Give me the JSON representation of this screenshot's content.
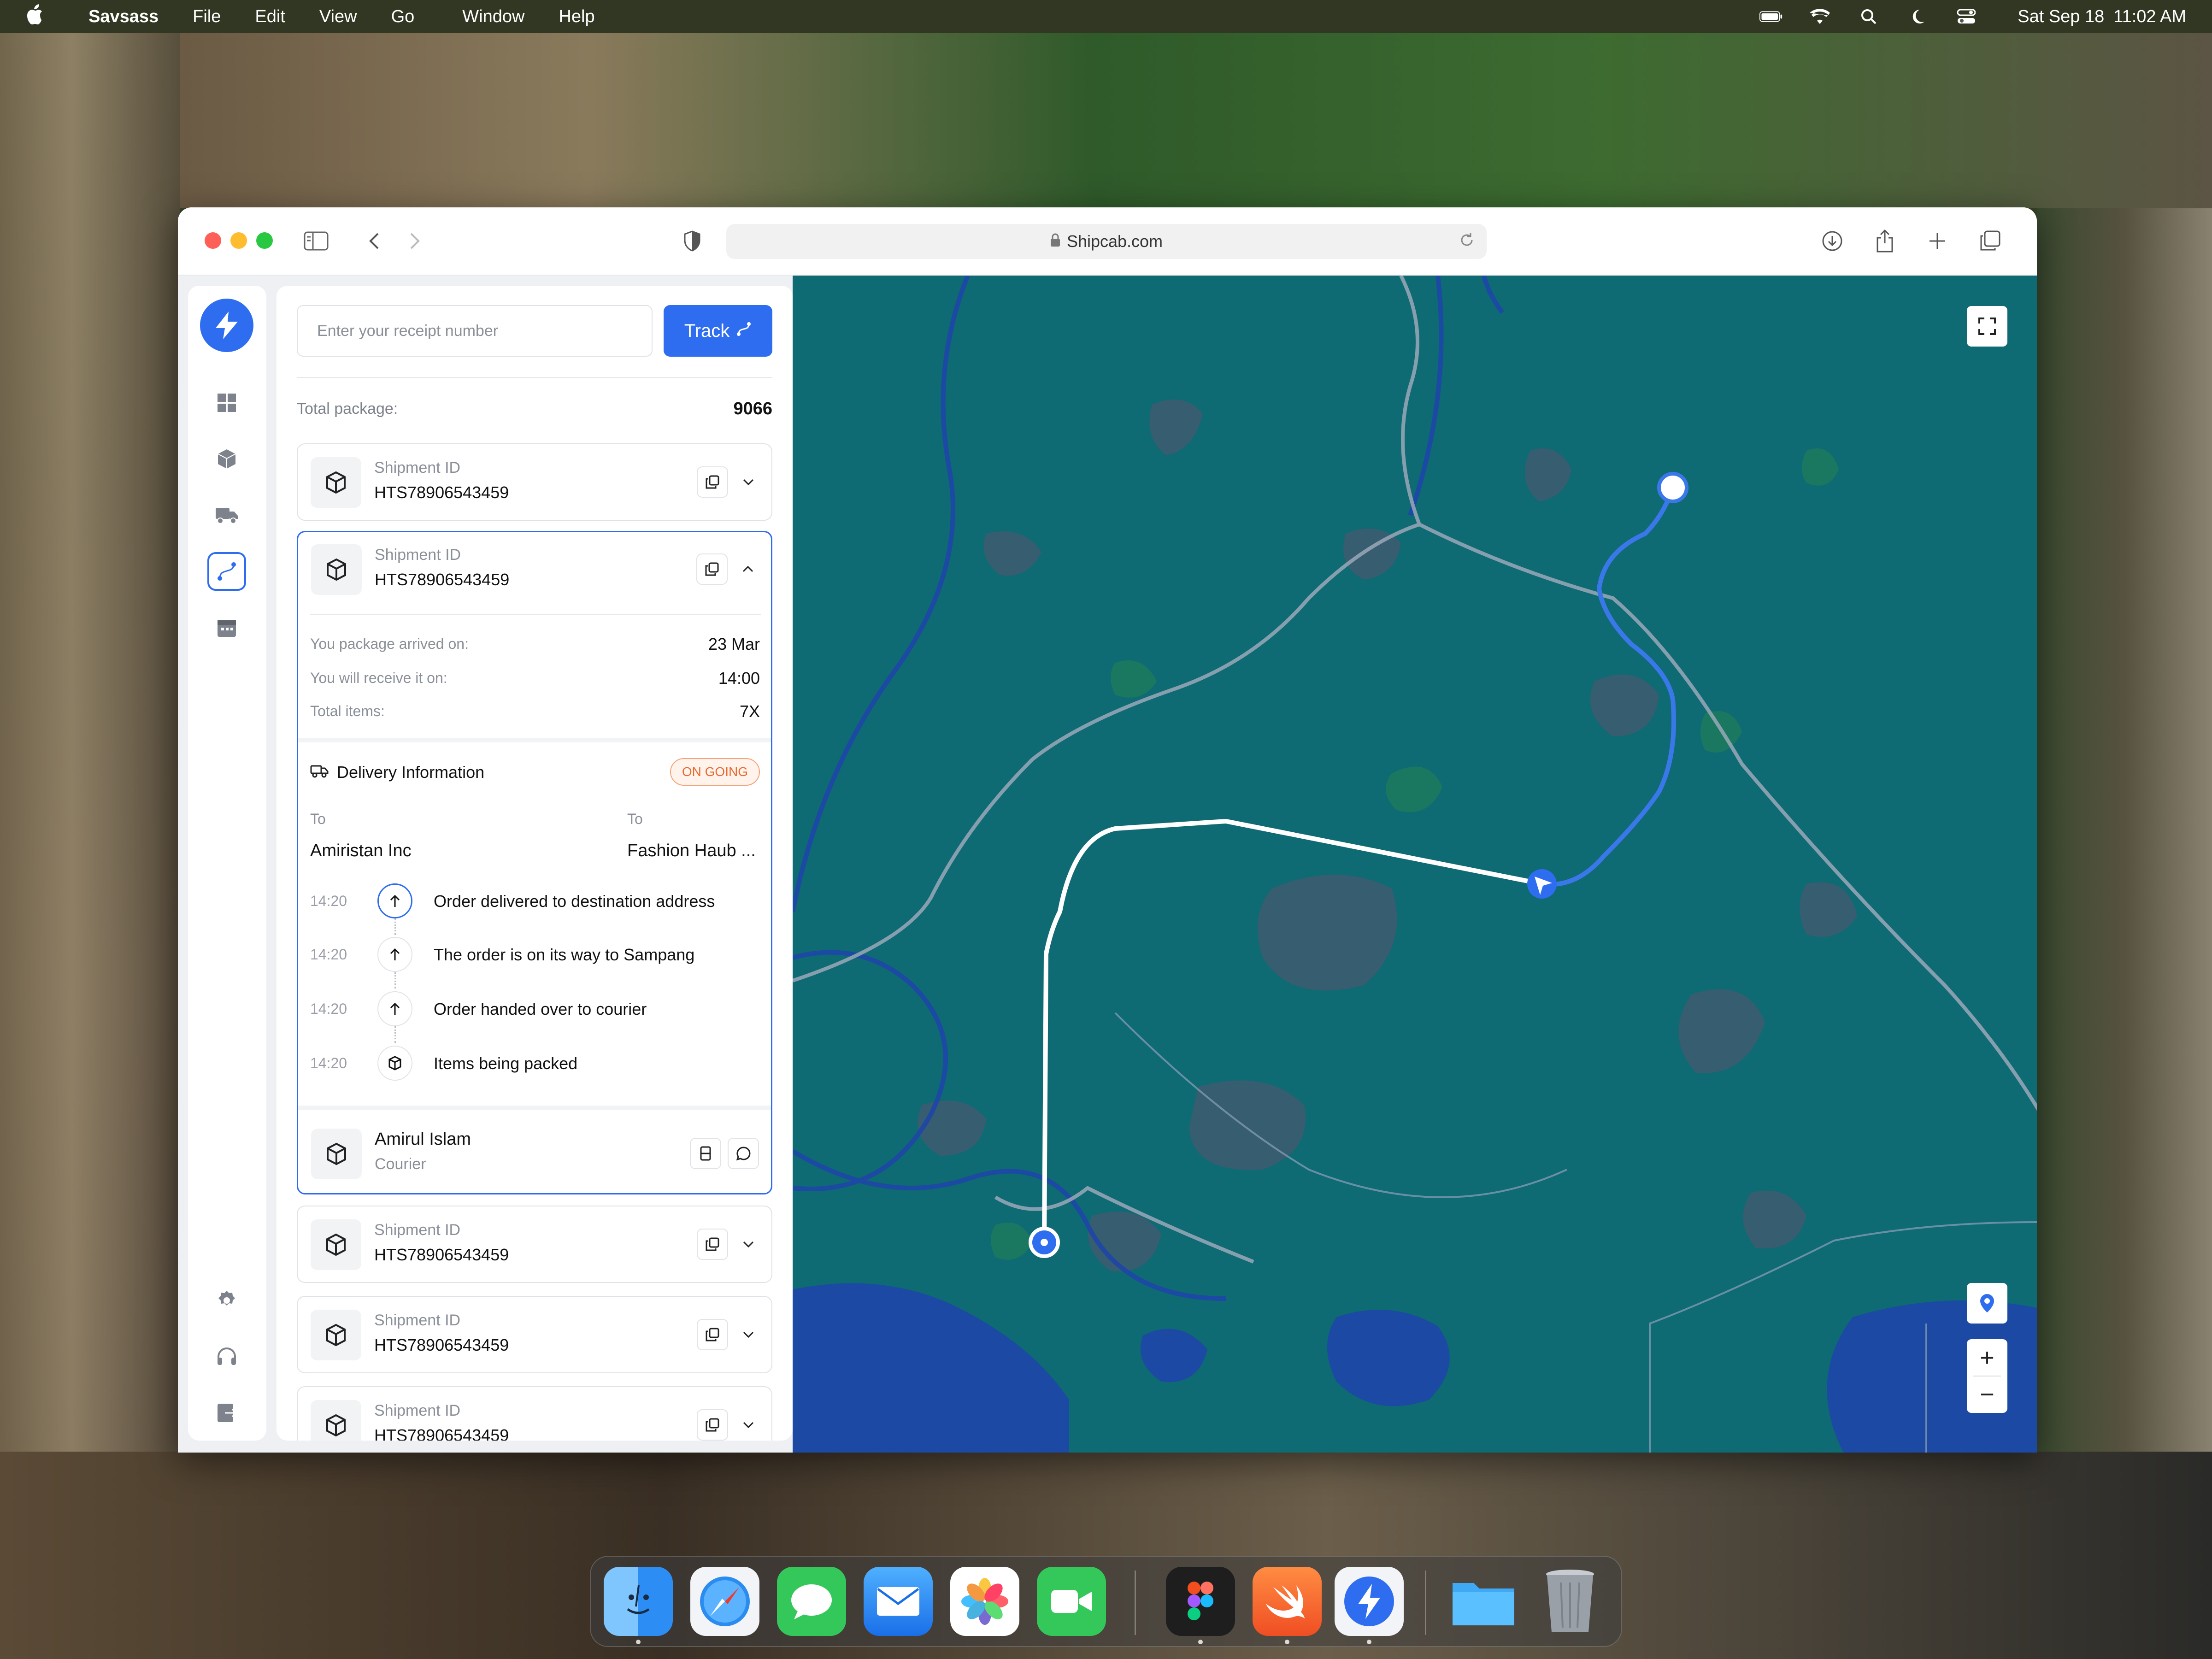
{
  "menubar": {
    "app_name": "Savsass",
    "menus": [
      "File",
      "Edit",
      "View",
      "Go",
      "Window",
      "Help"
    ],
    "date": "Sat Sep 18",
    "time": "11:02 AM"
  },
  "browser": {
    "url": "Shipcab.com"
  },
  "panel": {
    "search_placeholder": "Enter your receipt number",
    "track_label": "Track",
    "total_label": "Total package:",
    "total_value": "9066",
    "shipments": [
      {
        "label": "Shipment ID",
        "id": "HTS78906543459"
      },
      {
        "label": "Shipment ID",
        "id": "HTS78906543459"
      },
      {
        "label": "Shipment ID",
        "id": "HTS78906543459"
      },
      {
        "label": "Shipment ID",
        "id": "HTS78906543459"
      },
      {
        "label": "Shipment ID",
        "id": "HTS78906543459"
      }
    ],
    "details": {
      "arrived_label": "You package arrived on:",
      "arrived_value": "23 Mar",
      "receive_label": "You will receive it on:",
      "receive_value": "14:00",
      "items_label": "Total items:",
      "items_value": "7X"
    },
    "delivery": {
      "title": "Delivery Information",
      "status": "ON GOING",
      "from_label": "To",
      "from_value": "Amiristan Inc",
      "to_label": "To",
      "to_value": "Fashion Haub ...",
      "timeline": [
        {
          "time": "14:20",
          "text": "Order delivered to destination address"
        },
        {
          "time": "14:20",
          "text": "The order is on its way to Sampang"
        },
        {
          "time": "14:20",
          "text": "Order handed over to courier"
        },
        {
          "time": "14:20",
          "text": "Items being packed"
        }
      ]
    },
    "courier": {
      "name": "Amirul Islam",
      "role": "Courier"
    }
  },
  "map": {
    "zoom_in": "+",
    "zoom_out": "−"
  },
  "colors": {
    "accent": "#2f6df0",
    "map_water": "#0e6a73",
    "status_orange": "#e8692f"
  }
}
